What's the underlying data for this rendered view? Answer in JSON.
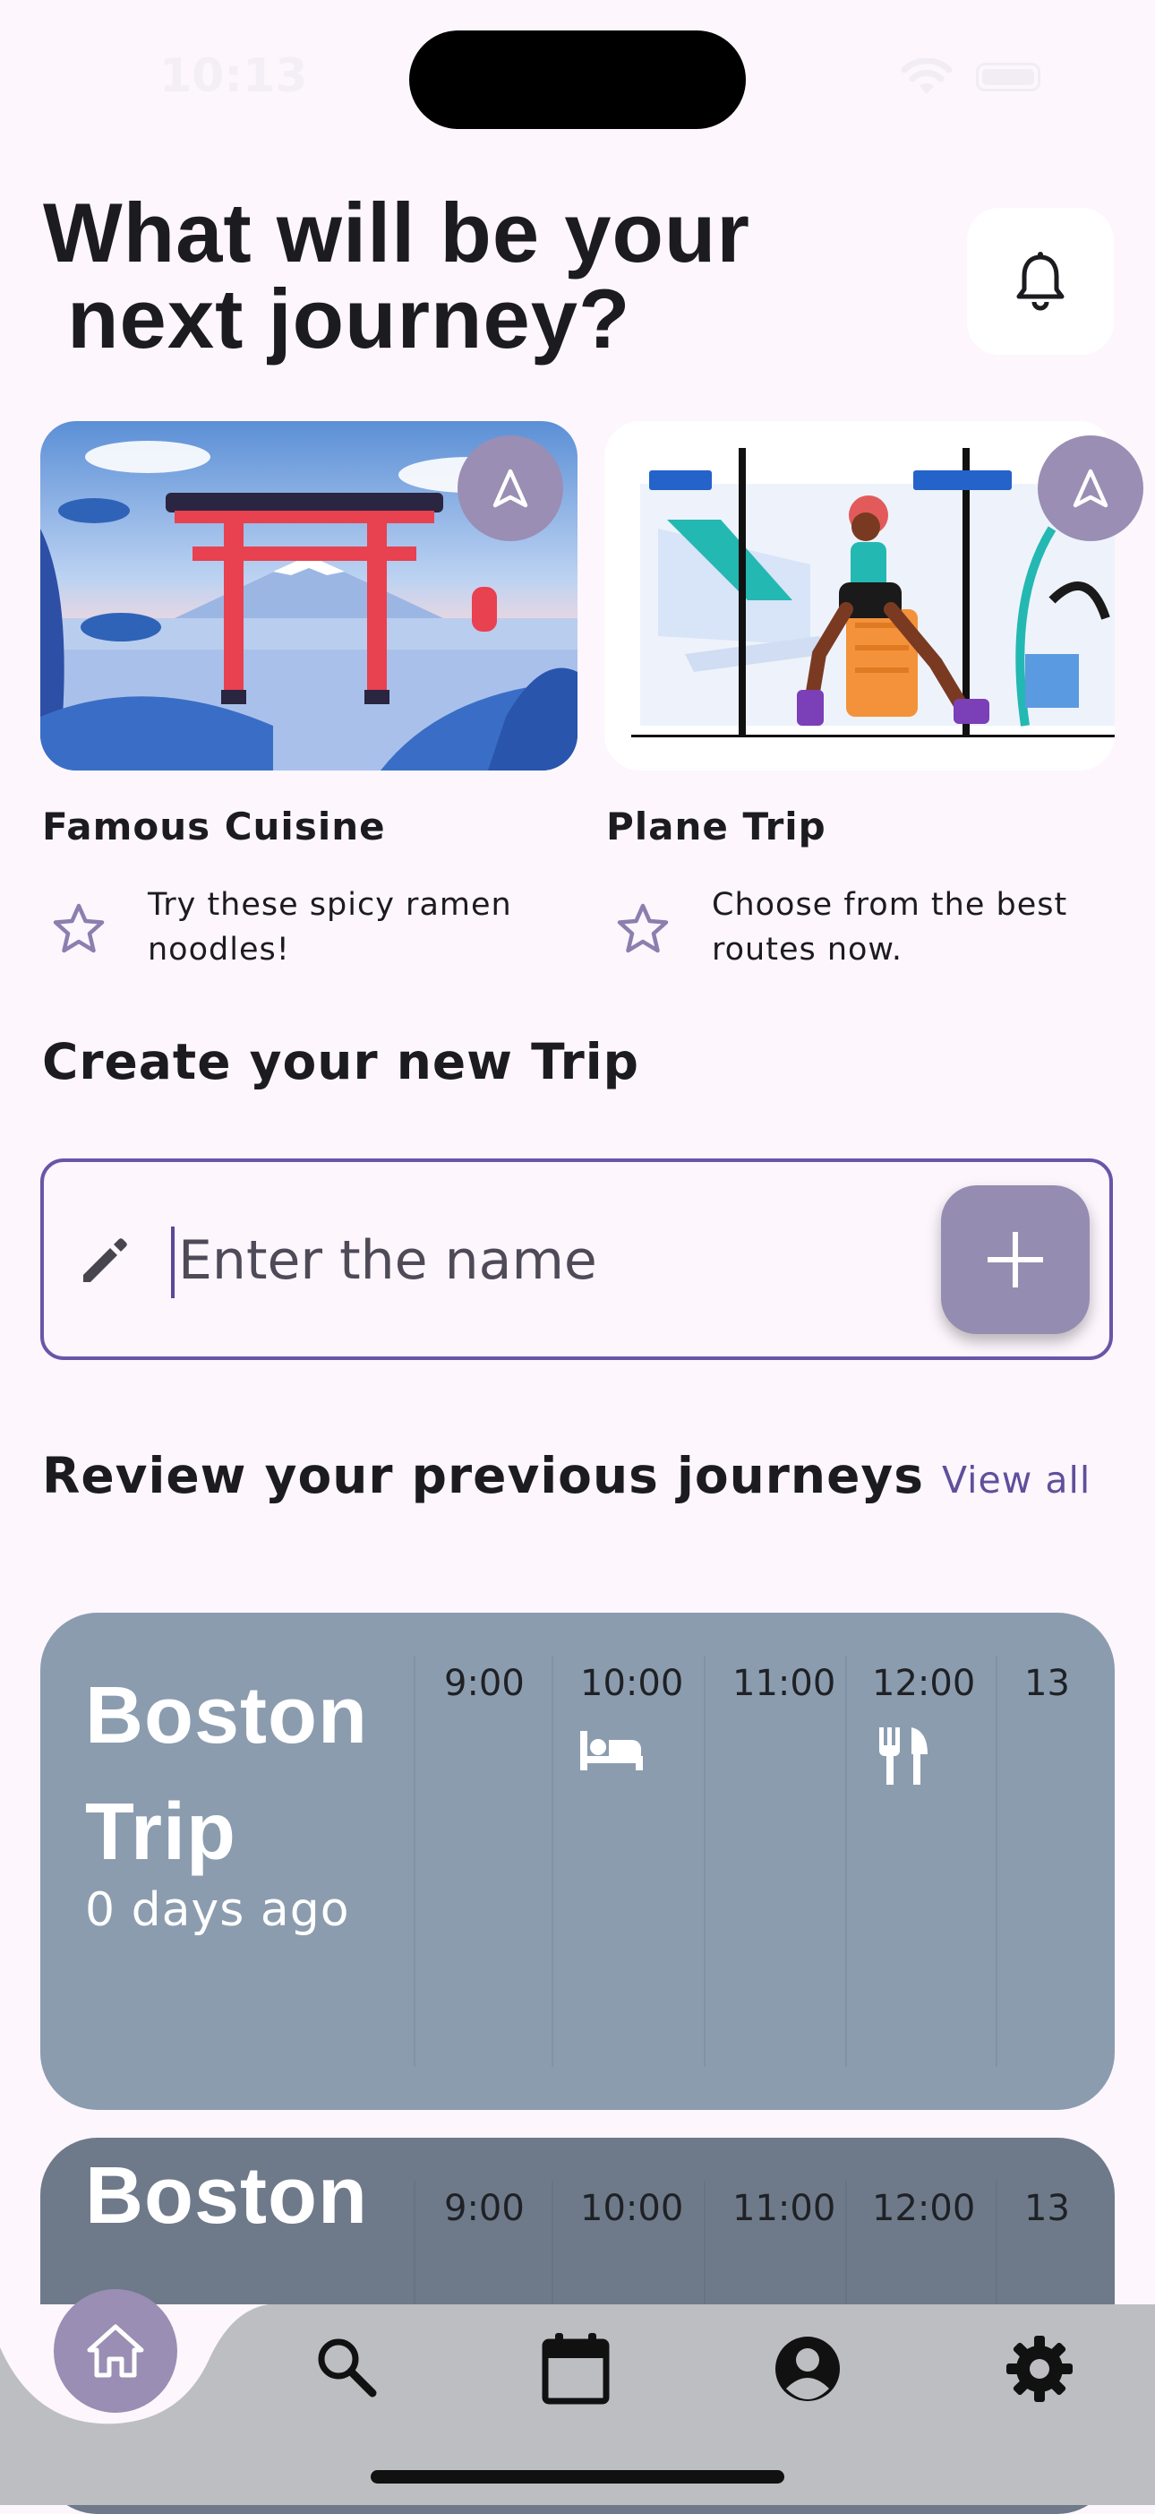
{
  "status_bar": {
    "time": "10:13"
  },
  "header": {
    "title": "What will be your\n next journey?",
    "bell_icon": "bell-icon"
  },
  "cards": [
    {
      "title": "Famous Cuisine",
      "description": "Try these spicy ramen noodles!",
      "image": "torii-gate-illustration",
      "badge_icon": "navigation-arrow-icon",
      "rating_icon": "star-outline-icon"
    },
    {
      "title": "Plane Trip",
      "description": "Choose from the best routes now.",
      "image": "airport-traveler-illustration",
      "badge_icon": "navigation-arrow-icon",
      "rating_icon": "star-outline-icon"
    }
  ],
  "create_trip": {
    "section_title": "Create your new Trip",
    "input_placeholder": "Enter the name",
    "input_value": "",
    "add_icon": "plus-icon"
  },
  "previous": {
    "section_title": "Review your previous journeys",
    "view_all_label": "View all",
    "journeys": [
      {
        "name": "Boston\nTrip",
        "ago": "0 days ago",
        "times": [
          "9:00",
          "10:00",
          "11:00",
          "12:00",
          "13"
        ],
        "icons": [
          "",
          "bed-icon",
          "",
          "cutlery-icon",
          ""
        ],
        "color": "#8b9caf"
      },
      {
        "name": "Boston",
        "ago": "",
        "times": [
          "9:00",
          "10:00",
          "11:00",
          "12:00",
          "13"
        ],
        "icons": [
          "",
          "",
          "",
          "",
          ""
        ],
        "color": "#6e7a8a"
      }
    ]
  },
  "bottom_nav": {
    "items": [
      "home-icon",
      "search-icon",
      "calendar-icon",
      "account-icon",
      "settings-icon"
    ],
    "active": "home-icon"
  },
  "colors": {
    "background": "#fdf6fd",
    "accent": "#958cb2",
    "input_border": "#6a55a8",
    "link": "#5f4f9c",
    "nav_bar": "#bdbec2"
  }
}
